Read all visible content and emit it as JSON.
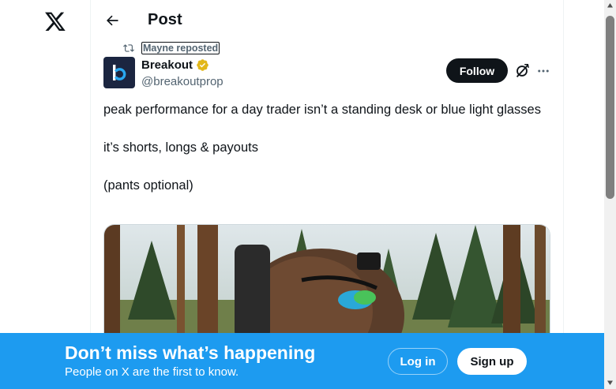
{
  "header": {
    "title": "Post"
  },
  "icons": {
    "logo": "x-logo-icon",
    "back": "arrow-left-icon",
    "repost": "repost-icon",
    "verified": "verified-badge-icon",
    "grok": "grok-icon",
    "more": "more-horizontal-icon"
  },
  "post": {
    "repost_label": "Mayne reposted",
    "author_name": "Breakout",
    "author_handle": "@breakoutprop",
    "follow_label": "Follow",
    "text_lines": [
      "peak performance for a day trader isn’t a standing desk or blue light glasses",
      "",
      "it’s shorts, longs & payouts",
      "",
      "(pants optional)"
    ]
  },
  "signup_banner": {
    "title": "Don’t miss what’s happening",
    "subtitle": "People on X are the first to know.",
    "login_label": "Log in",
    "signup_label": "Sign up"
  },
  "colors": {
    "accent": "#1d9bf0",
    "text_primary": "#0f1419",
    "text_secondary": "#536471",
    "verified_gold": "#e2b719",
    "avatar_bg": "#1b2540"
  },
  "scrollbar": {
    "position_fraction": 0.0,
    "visible_fraction": 0.47
  }
}
